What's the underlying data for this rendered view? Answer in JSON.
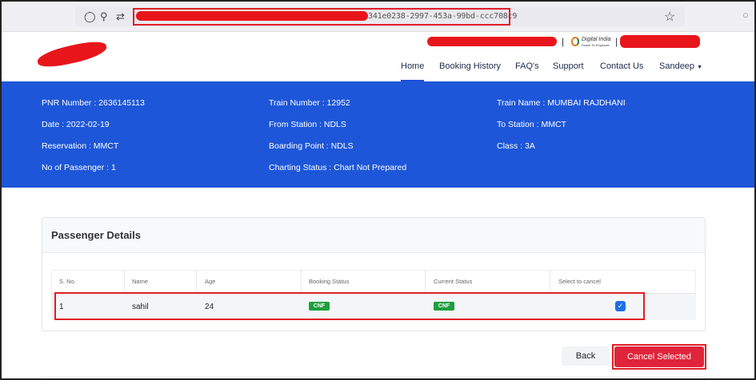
{
  "browser": {
    "url_visible": "341e0238-2997-453a-99bd-ccc708c9",
    "icons": [
      "shield-icon",
      "lock-icon",
      "permissions-icon",
      "bookmark-star-icon"
    ]
  },
  "nav": {
    "home": "Home",
    "booking_history": "Booking History",
    "faqs": "FAQ's",
    "support": "Support",
    "contact_us": "Contact Us",
    "user": "Sandeep",
    "digital_india": "Digital India",
    "digital_india_tag": "Power To Empower"
  },
  "journey": {
    "pnr": "PNR Number : 2636145113",
    "date": "Date : 2022-02-19",
    "reservation": "Reservation : MMCT",
    "passengers": "No of Passenger : 1",
    "train_number": "Train Number : 12952",
    "from_station": "From Station : NDLS",
    "boarding_point": "Boarding Point : NDLS",
    "charting_status": "Charting Status : Chart Not Prepared",
    "train_name": "Train Name : MUMBAI RAJDHANI",
    "to_station": "To Station : MMCT",
    "class": "Class : 3A"
  },
  "passenger_card": {
    "title": "Passenger Details",
    "headers": [
      "S. No.",
      "Name",
      "Age",
      "Booking Status",
      "Current Status",
      "Select to cancel"
    ],
    "rows": [
      {
        "sno": "1",
        "name": "sahil",
        "age": "24",
        "booking_status": "CNF",
        "current_status": "CNF",
        "selected": true
      }
    ]
  },
  "actions": {
    "back": "Back",
    "cancel_selected": "Cancel Selected"
  },
  "colors": {
    "band": "#1d56d8",
    "cancel_button": "#e0243a",
    "cnf_badge": "#1e9e3e",
    "annotation_red": "#e01e24"
  }
}
